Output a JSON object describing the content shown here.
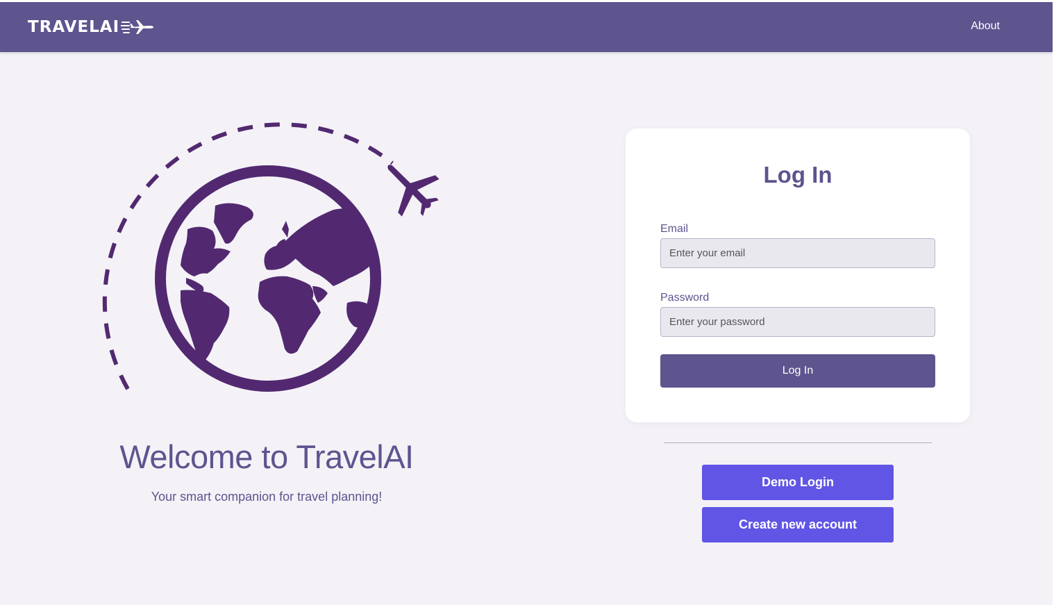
{
  "nav": {
    "logo_text": "TRAVELAI",
    "about_label": "About"
  },
  "hero": {
    "title": "Welcome to TravelAI",
    "subtitle": "Your smart companion for travel planning!",
    "illustration": "globe-with-airplane-icon"
  },
  "login_card": {
    "title": "Log In",
    "email_label": "Email",
    "email_placeholder": "Enter your email",
    "email_value": "",
    "password_label": "Password",
    "password_placeholder": "Enter your password",
    "password_value": "",
    "submit_label": "Log In"
  },
  "alt_actions": {
    "demo_label": "Demo Login",
    "signup_label": "Create new account"
  },
  "colors": {
    "brand": "#5e548e",
    "illustration": "#522970",
    "accent_button": "#6155e6",
    "background": "#f4f2f7"
  }
}
